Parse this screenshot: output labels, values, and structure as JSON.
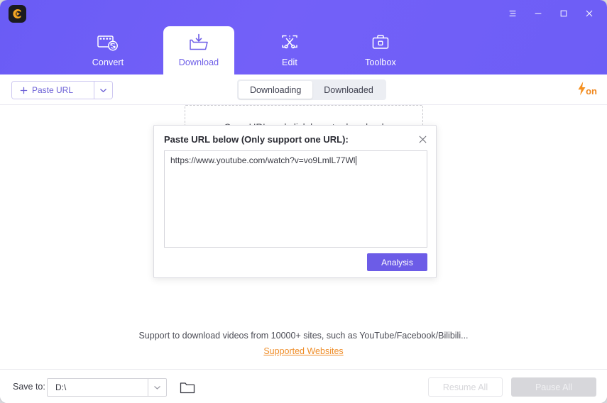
{
  "window": {
    "logo_icon": "app-logo-c-play",
    "controls": [
      {
        "name": "menu",
        "icon": "hamburger-menu-icon"
      },
      {
        "name": "minimize",
        "icon": "minimize-icon"
      },
      {
        "name": "maximize",
        "icon": "maximize-icon"
      },
      {
        "name": "close",
        "icon": "close-icon"
      }
    ]
  },
  "nav": {
    "tabs": [
      {
        "label": "Convert",
        "icon": "film-convert-icon",
        "active": false
      },
      {
        "label": "Download",
        "icon": "folder-download-icon",
        "active": true
      },
      {
        "label": "Edit",
        "icon": "screen-scissors-icon",
        "active": false
      },
      {
        "label": "Toolbox",
        "icon": "toolbox-icon",
        "active": false
      }
    ]
  },
  "toolbar": {
    "paste_url_label": "Paste URL",
    "paste_url_plus_icon": "plus-icon",
    "paste_url_caret_icon": "chevron-down-icon",
    "segments": [
      {
        "label": "Downloading",
        "active": true
      },
      {
        "label": "Downloaded",
        "active": false
      }
    ],
    "turbo": {
      "icon": "lightning-bolt-icon",
      "label": "on",
      "color": "#f0881f"
    }
  },
  "main": {
    "dropzone_text": "Copy URL and click here to download",
    "support_text": "Support to download videos from 10000+ sites, such as YouTube/Facebook/Bilibili...",
    "support_link": "Supported Websites"
  },
  "modal": {
    "title": "Paste URL below (Only support one URL):",
    "close_icon": "close-icon",
    "url_value": "https://www.youtube.com/watch?v=vo9LmlL77Wl",
    "url_placeholder": "",
    "analysis_label": "Analysis",
    "accent_color": "#6c5ce7"
  },
  "footer": {
    "save_to_label": "Save to:",
    "path_value": "D:\\",
    "path_caret_icon": "chevron-down-icon",
    "folder_icon": "folder-icon",
    "resume_all_label": "Resume All",
    "pause_all_label": "Pause All"
  }
}
